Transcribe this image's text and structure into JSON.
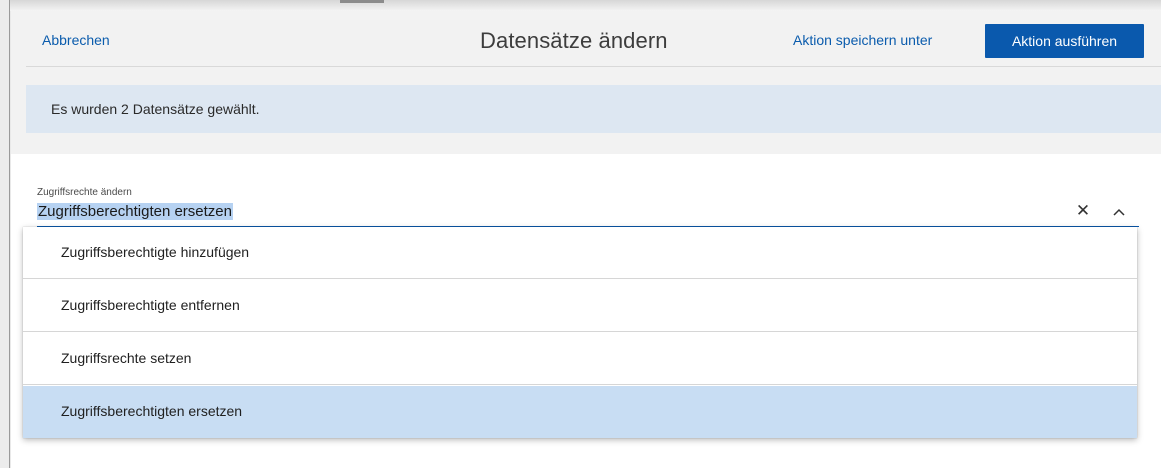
{
  "header": {
    "cancel_label": "Abbrechen",
    "title": "Datensätze ändern",
    "save_as_label": "Aktion speichern unter",
    "run_label": "Aktion ausführen"
  },
  "info": {
    "message": "Es wurden 2 Datensätze gewählt."
  },
  "field": {
    "label": "Zugriffsrechte ändern",
    "value": "Zugriffsberechtigten ersetzen",
    "clear_icon": "close-icon",
    "collapse_icon": "chevron-up-icon"
  },
  "dropdown": {
    "options": [
      {
        "label": "Zugriffsberechtigte hinzufügen",
        "selected": false
      },
      {
        "label": "Zugriffsberechtigte entfernen",
        "selected": false
      },
      {
        "label": "Zugriffsrechte setzen",
        "selected": false
      },
      {
        "label": "Zugriffsberechtigten ersetzen",
        "selected": true
      }
    ]
  },
  "colors": {
    "accent": "#0a59ad",
    "link": "#0b5cad",
    "banner_bg": "#dde7f2",
    "selected_option_bg": "#c8ddf3",
    "text_highlight": "#b6d2f2"
  }
}
